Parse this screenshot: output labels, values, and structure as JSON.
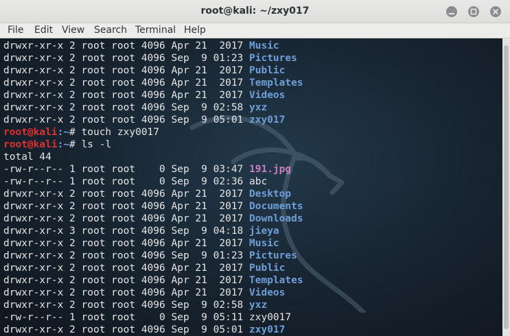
{
  "window": {
    "title": "root@kali: ~/zxy017"
  },
  "menu": [
    "File",
    "Edit",
    "View",
    "Search",
    "Terminal",
    "Help"
  ],
  "terminal": {
    "lines": [
      {
        "type": "ls",
        "perms": "drwxr-xr-x",
        "links": "2",
        "owner": "root",
        "group": "root",
        "size": "4096",
        "month": "Apr",
        "day": "21",
        "time": " 2017",
        "name": "Music",
        "kind": "dir"
      },
      {
        "type": "ls",
        "perms": "drwxr-xr-x",
        "links": "2",
        "owner": "root",
        "group": "root",
        "size": "4096",
        "month": "Sep",
        "day": " 9",
        "time": "01:23",
        "name": "Pictures",
        "kind": "dir"
      },
      {
        "type": "ls",
        "perms": "drwxr-xr-x",
        "links": "2",
        "owner": "root",
        "group": "root",
        "size": "4096",
        "month": "Apr",
        "day": "21",
        "time": " 2017",
        "name": "Public",
        "kind": "dir"
      },
      {
        "type": "ls",
        "perms": "drwxr-xr-x",
        "links": "2",
        "owner": "root",
        "group": "root",
        "size": "4096",
        "month": "Apr",
        "day": "21",
        "time": " 2017",
        "name": "Templates",
        "kind": "dir"
      },
      {
        "type": "ls",
        "perms": "drwxr-xr-x",
        "links": "2",
        "owner": "root",
        "group": "root",
        "size": "4096",
        "month": "Apr",
        "day": "21",
        "time": " 2017",
        "name": "Videos",
        "kind": "dir"
      },
      {
        "type": "ls",
        "perms": "drwxr-xr-x",
        "links": "2",
        "owner": "root",
        "group": "root",
        "size": "4096",
        "month": "Sep",
        "day": " 9",
        "time": "02:58",
        "name": "yxz",
        "kind": "dir"
      },
      {
        "type": "ls",
        "perms": "drwxr-xr-x",
        "links": "2",
        "owner": "root",
        "group": "root",
        "size": "4096",
        "month": "Sep",
        "day": " 9",
        "time": "05:01",
        "name": "zxy017",
        "kind": "dir"
      },
      {
        "type": "prompt",
        "user": "root@kali",
        "path": ":~",
        "symbol": "# ",
        "command": "touch zxy0017"
      },
      {
        "type": "prompt",
        "user": "root@kali",
        "path": ":~",
        "symbol": "# ",
        "command": "ls -l"
      },
      {
        "type": "text",
        "text": "total 44"
      },
      {
        "type": "ls",
        "perms": "-rw-r--r--",
        "links": "1",
        "owner": "root",
        "group": "root",
        "size": "   0",
        "month": "Sep",
        "day": " 9",
        "time": "03:47",
        "name": "191.jpg",
        "kind": "img"
      },
      {
        "type": "ls",
        "perms": "-rw-r--r--",
        "links": "1",
        "owner": "root",
        "group": "root",
        "size": "   0",
        "month": "Sep",
        "day": " 9",
        "time": "02:36",
        "name": "abc",
        "kind": "file"
      },
      {
        "type": "ls",
        "perms": "drwxr-xr-x",
        "links": "2",
        "owner": "root",
        "group": "root",
        "size": "4096",
        "month": "Apr",
        "day": "21",
        "time": " 2017",
        "name": "Desktop",
        "kind": "dir"
      },
      {
        "type": "ls",
        "perms": "drwxr-xr-x",
        "links": "2",
        "owner": "root",
        "group": "root",
        "size": "4096",
        "month": "Apr",
        "day": "21",
        "time": " 2017",
        "name": "Documents",
        "kind": "dir"
      },
      {
        "type": "ls",
        "perms": "drwxr-xr-x",
        "links": "2",
        "owner": "root",
        "group": "root",
        "size": "4096",
        "month": "Apr",
        "day": "21",
        "time": " 2017",
        "name": "Downloads",
        "kind": "dir"
      },
      {
        "type": "ls",
        "perms": "drwxr-xr-x",
        "links": "3",
        "owner": "root",
        "group": "root",
        "size": "4096",
        "month": "Sep",
        "day": " 9",
        "time": "04:18",
        "name": "jieya",
        "kind": "dir"
      },
      {
        "type": "ls",
        "perms": "drwxr-xr-x",
        "links": "2",
        "owner": "root",
        "group": "root",
        "size": "4096",
        "month": "Apr",
        "day": "21",
        "time": " 2017",
        "name": "Music",
        "kind": "dir"
      },
      {
        "type": "ls",
        "perms": "drwxr-xr-x",
        "links": "2",
        "owner": "root",
        "group": "root",
        "size": "4096",
        "month": "Sep",
        "day": " 9",
        "time": "01:23",
        "name": "Pictures",
        "kind": "dir"
      },
      {
        "type": "ls",
        "perms": "drwxr-xr-x",
        "links": "2",
        "owner": "root",
        "group": "root",
        "size": "4096",
        "month": "Apr",
        "day": "21",
        "time": " 2017",
        "name": "Public",
        "kind": "dir"
      },
      {
        "type": "ls",
        "perms": "drwxr-xr-x",
        "links": "2",
        "owner": "root",
        "group": "root",
        "size": "4096",
        "month": "Apr",
        "day": "21",
        "time": " 2017",
        "name": "Templates",
        "kind": "dir"
      },
      {
        "type": "ls",
        "perms": "drwxr-xr-x",
        "links": "2",
        "owner": "root",
        "group": "root",
        "size": "4096",
        "month": "Apr",
        "day": "21",
        "time": " 2017",
        "name": "Videos",
        "kind": "dir"
      },
      {
        "type": "ls",
        "perms": "drwxr-xr-x",
        "links": "2",
        "owner": "root",
        "group": "root",
        "size": "4096",
        "month": "Sep",
        "day": " 9",
        "time": "02:58",
        "name": "yxz",
        "kind": "dir"
      },
      {
        "type": "ls",
        "perms": "-rw-r--r--",
        "links": "1",
        "owner": "root",
        "group": "root",
        "size": "   0",
        "month": "Sep",
        "day": " 9",
        "time": "05:11",
        "name": "zxy0017",
        "kind": "file"
      },
      {
        "type": "ls",
        "perms": "drwxr-xr-x",
        "links": "2",
        "owner": "root",
        "group": "root",
        "size": "4096",
        "month": "Sep",
        "day": " 9",
        "time": "05:01",
        "name": "zxy017",
        "kind": "dir"
      }
    ]
  },
  "colors": {
    "directory": "#6f9fd8",
    "image_file": "#c67fc1",
    "prompt_user": "#e0302f",
    "text": "#e6e6e6",
    "background": "#17232f"
  },
  "icons": {
    "minimize": "minimize-icon",
    "maximize": "maximize-icon",
    "close": "close-icon",
    "background": "kali-dragon-icon"
  }
}
